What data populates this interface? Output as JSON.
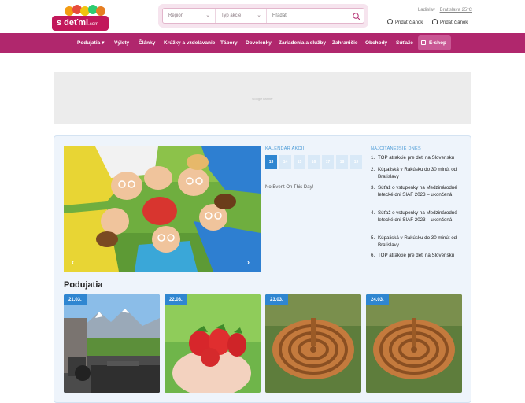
{
  "header": {
    "logo_text": "s deťmi",
    "logo_domain": ".com",
    "search": {
      "region_placeholder": "Región",
      "type_placeholder": "Typ akcie",
      "query_placeholder": "Hľadať"
    },
    "user_name": "Ladislav",
    "weather": "Bratislava 25°C",
    "add_article": "Pridať článok",
    "add_article_2": "Pridať článok"
  },
  "nav": {
    "items": [
      "Podujatia",
      "Výlety",
      "Články",
      "Krúžky a vzdelávanie",
      "Tábory",
      "Dovolenky",
      "Zariadenia a služby",
      "Zahraničie",
      "Obchody",
      "Súťaže"
    ],
    "eshop": "E-shop"
  },
  "ad": {
    "label": "Google banner"
  },
  "calendar": {
    "title": "KALENDÁR AKCIÍ",
    "days": [
      "13",
      "14",
      "15",
      "16",
      "17",
      "18",
      "19"
    ],
    "active_day": "13",
    "no_event": "No Event On This Day!"
  },
  "popular": {
    "title": "NAJČÍTANEJŠIE DNES",
    "items": [
      {
        "num": "1.",
        "text": "TOP atrakcie pre deti na Slovensku"
      },
      {
        "num": "2.",
        "text": "Kúpaliská v Rakúsku do 30 minút od Bratislavy"
      },
      {
        "num": "3.",
        "text": "Súťaž o vstupenky na Medzinárodné letecké dni SIAF 2023 – ukončená"
      },
      {
        "num": "4.",
        "text": "Súťaž o vstupenky na Medzinárodné letecké dni SIAF 2023 – ukončená"
      },
      {
        "num": "5.",
        "text": "Kúpaliská v Rakúsku do 30 minút od Bratislavy"
      },
      {
        "num": "6.",
        "text": "TOP atrakcie pre deti na Slovensku"
      }
    ]
  },
  "events": {
    "section_title": "Podujatia",
    "cards": [
      {
        "date": "21.03.",
        "image": "camper-mountains-photo"
      },
      {
        "date": "22.03.",
        "image": "strawberries-hand-photo"
      },
      {
        "date": "23.03.",
        "image": "wooden-maze-photo"
      },
      {
        "date": "24.03.",
        "image": "wooden-maze-photo"
      }
    ]
  },
  "slider": {
    "prev_icon": "chevron-left-icon",
    "next_icon": "chevron-right-icon"
  },
  "colors": {
    "brand": "#b0276d",
    "accent": "#2f86d1",
    "panel": "#eef4fb"
  }
}
